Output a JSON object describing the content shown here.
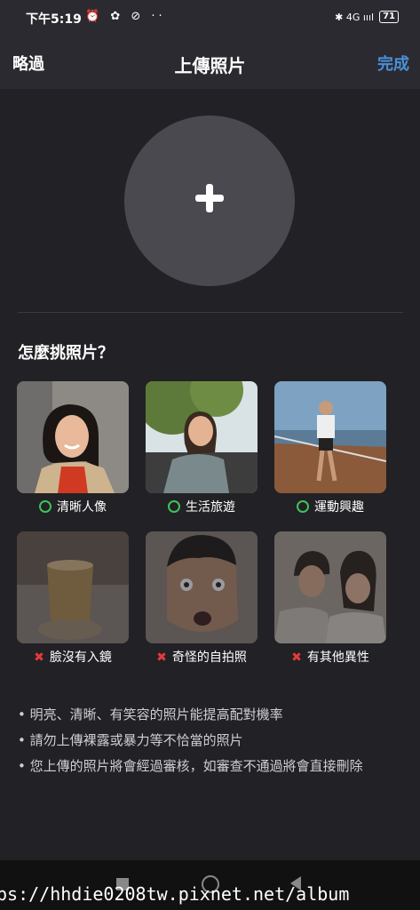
{
  "status_bar": {
    "time": "下午5:19",
    "left_icons": "⏰ ✿ ⊘  ··",
    "network": "✱ 4G ıııl",
    "battery": "71"
  },
  "header": {
    "skip": "略過",
    "title": "上傳照片",
    "done": "完成"
  },
  "upload": {
    "icon": "plus-icon"
  },
  "guide": {
    "heading": "怎麼挑照片？",
    "good": [
      {
        "label": "清晰人像"
      },
      {
        "label": "生活旅遊"
      },
      {
        "label": "運動興趣"
      }
    ],
    "bad": [
      {
        "label": "臉沒有入鏡"
      },
      {
        "label": "奇怪的自拍照"
      },
      {
        "label": "有其他異性"
      }
    ]
  },
  "tips": [
    "• 明亮、清晰、有笑容的照片能提高配對機率",
    "• 請勿上傳裸露或暴力等不恰當的照片",
    "• 您上傳的照片將會經過審核，如審查不通過將會直接刪除"
  ],
  "watermark": "ps://hhdie0208tw.pixnet.net/album",
  "colors": {
    "accent": "#4a90d9",
    "ok": "#3fc35a",
    "bad": "#e23b3b"
  }
}
